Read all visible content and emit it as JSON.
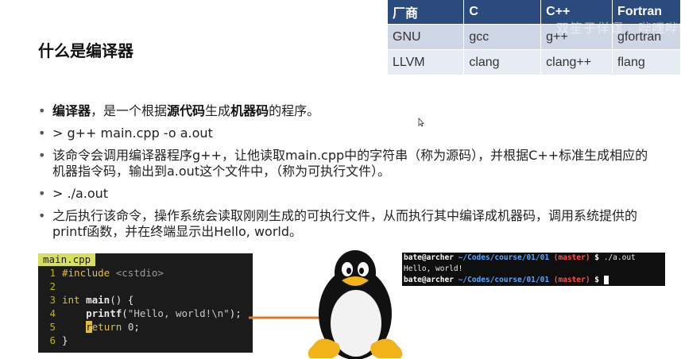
{
  "slide": {
    "title": "什么是编译器"
  },
  "table": {
    "headers": [
      "厂商",
      "C",
      "C++",
      "Fortran"
    ],
    "rows": [
      [
        "GNU",
        "gcc",
        "g++",
        "gfortran"
      ],
      [
        "LLVM",
        "clang",
        "clang++",
        "flang"
      ]
    ],
    "header_color": "#2b4a7d"
  },
  "watermark": "双笙子佯谬 · 哔哩哔哩",
  "bullets": [
    {
      "parts": [
        {
          "text": "编译器",
          "bold": true
        },
        {
          "text": "，是一个根据",
          "bold": false
        },
        {
          "text": "源代码",
          "bold": true
        },
        {
          "text": "生成",
          "bold": false
        },
        {
          "text": "机器码",
          "bold": true
        },
        {
          "text": "的程序。",
          "bold": false
        }
      ]
    },
    {
      "parts": [
        {
          "text": "> g++ main.cpp -o a.out",
          "bold": false
        }
      ]
    },
    {
      "parts": [
        {
          "text": "该命令会调用编译器程序g++，让他读取main.cpp中的字符串（称为源码），并根据C++标准生成相应的机器指令码，输出到a.out这个文件中，（称为可执行文件）。",
          "bold": false
        }
      ]
    },
    {
      "parts": [
        {
          "text": "> ./a.out",
          "bold": false
        }
      ]
    },
    {
      "parts": [
        {
          "text": "之后执行该命令，操作系统会读取刚刚生成的可执行文件，从而执行其中编译成机器码，调用系统提供的printf函数，并在终端显示出Hello, world。",
          "bold": false
        }
      ]
    }
  ],
  "code": {
    "tab": "main.cpp",
    "lines": [
      {
        "n": "1",
        "text": "#include <cstdio>"
      },
      {
        "n": "2",
        "text": ""
      },
      {
        "n": "3",
        "text": "int main() {"
      },
      {
        "n": "4",
        "text": "    printf(\"Hello, world!\\n\");"
      },
      {
        "n": "5",
        "text": "    return 0;"
      },
      {
        "n": "6",
        "text": "}"
      }
    ]
  },
  "terminal": {
    "lines": [
      {
        "user": "bate@archer",
        "path": "~/Codes/course/01/01",
        "branch": "(master)",
        "prompt": "$",
        "cmd": " ./a.out"
      },
      {
        "output": "Hello, world!"
      },
      {
        "user": "bate@archer",
        "path": "~/Codes/course/01/01",
        "branch": "(master)",
        "prompt": "$",
        "cmd": " "
      }
    ]
  },
  "colors": {
    "arrow": "#e07a2a",
    "code_bg": "#1b1b1b",
    "tab_bg": "#d7e05a"
  }
}
